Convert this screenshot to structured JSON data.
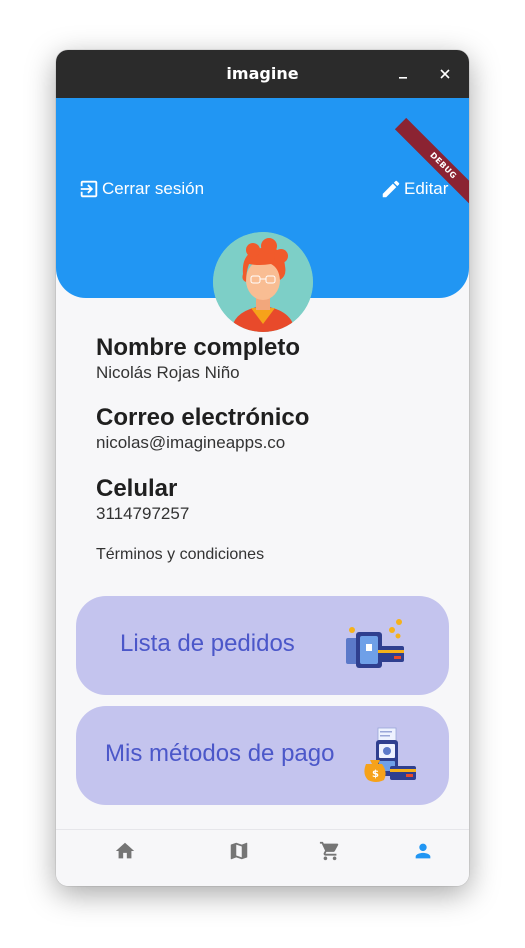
{
  "window": {
    "title": "imagine"
  },
  "header": {
    "logout_label": "Cerrar sesión",
    "edit_label": "Editar",
    "debug_label": "DEBUG",
    "color": "#2196f3"
  },
  "profile": {
    "fields": [
      {
        "label": "Nombre completo",
        "value": "Nicolás Rojas Niño"
      },
      {
        "label": "Correo electrónico",
        "value": "nicolas@imagineapps.co"
      },
      {
        "label": "Celular",
        "value": "3114797257"
      }
    ],
    "terms_link": "Términos y condiciones"
  },
  "cards": [
    {
      "label": "Lista de pedidos",
      "icon": "payment-terminal-icon"
    },
    {
      "label": "Mis métodos de pago",
      "icon": "payment-methods-icon"
    }
  ],
  "bottom_nav": {
    "items": [
      {
        "icon": "home-icon",
        "active": false
      },
      {
        "icon": "map-icon",
        "active": false
      },
      {
        "icon": "cart-icon",
        "active": false
      },
      {
        "icon": "person-icon",
        "active": true
      }
    ],
    "active_color": "#2196f3",
    "inactive_color": "#757575"
  }
}
